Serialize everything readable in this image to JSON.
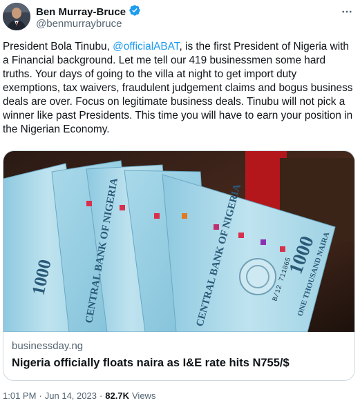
{
  "author": {
    "display_name": "Ben Murray-Bruce",
    "handle": "@benmurraybruce"
  },
  "tweet": {
    "text_before_mention": "President Bola Tinubu, ",
    "mention": "@officialABAT",
    "text_after_mention": ", is the first President of Nigeria with a Financial background. Let me tell our 419 businessmen some hard truths. Your days of going to the villa at night to get import duty exemptions, tax waivers, fraudulent judgement claims and bogus business deals are over. Focus on legitimate business deals. Tinubu will not pick a winner like past Presidents. This time you will have to earn your position in the Nigerian Economy."
  },
  "card": {
    "domain": "businessday.ng",
    "title": "Nigeria officially floats naira as I&E rate hits N755/$",
    "image_text": {
      "denomination": "1000",
      "bank_name": "CENTRAL BANK OF NIGERIA",
      "currency_words": "ONE THOUSAND NAIRA",
      "serial": "B/12 711865"
    }
  },
  "meta": {
    "time": "1:01 PM",
    "separator": "·",
    "date": "Jun 14, 2023",
    "views_count": "82.7K",
    "views_label": "Views"
  },
  "icons": {
    "verified": "verified-badge-icon",
    "more": "more-options-icon"
  },
  "colors": {
    "accent": "#1d9bf0",
    "text": "#0f1419",
    "secondary": "#536471",
    "border": "#cfd9de"
  }
}
